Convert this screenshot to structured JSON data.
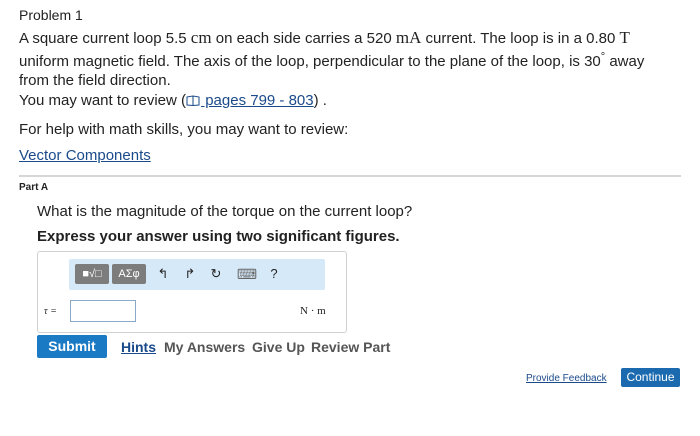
{
  "problem": {
    "title": "Problem 1",
    "text_pre1": "A square current loop 5.5 ",
    "unit_cm": "cm",
    "text_mid1": " on each side carries a 520 ",
    "unit_mA": "mA",
    "text_mid2": " current. The loop is in a 0.80 ",
    "unit_T": "T",
    "text_mid3": " uniform magnetic field. The axis of the loop, perpendicular to the plane of the loop, is 30",
    "degree": "°",
    "text_end": " away from the field direction."
  },
  "review": {
    "prefix": "You may want to review (",
    "link_text": " pages 799 - 803",
    "suffix": ") ."
  },
  "math_help": "For help with math skills, you may want to review:",
  "vector_link": "Vector Components",
  "part": {
    "label": "Part A",
    "question": "What is the magnitude of the torque on the current loop?",
    "instruction": "Express your answer using two significant figures."
  },
  "toolbar": {
    "templates_label": "■√□",
    "greek_label": "ΑΣφ",
    "undo_icon": "↰",
    "redo_icon": "↱",
    "reset_icon": "↻",
    "keyboard_icon": "⌨",
    "help_label": "?"
  },
  "answer": {
    "variable": "τ =",
    "value": "",
    "unit": "N · m"
  },
  "actions": {
    "submit": "Submit",
    "hints": "Hints",
    "my_answers": "My Answers",
    "give_up": "Give Up",
    "review_part": "Review Part"
  },
  "footer": {
    "feedback": "Provide Feedback",
    "continue": "Continue"
  }
}
